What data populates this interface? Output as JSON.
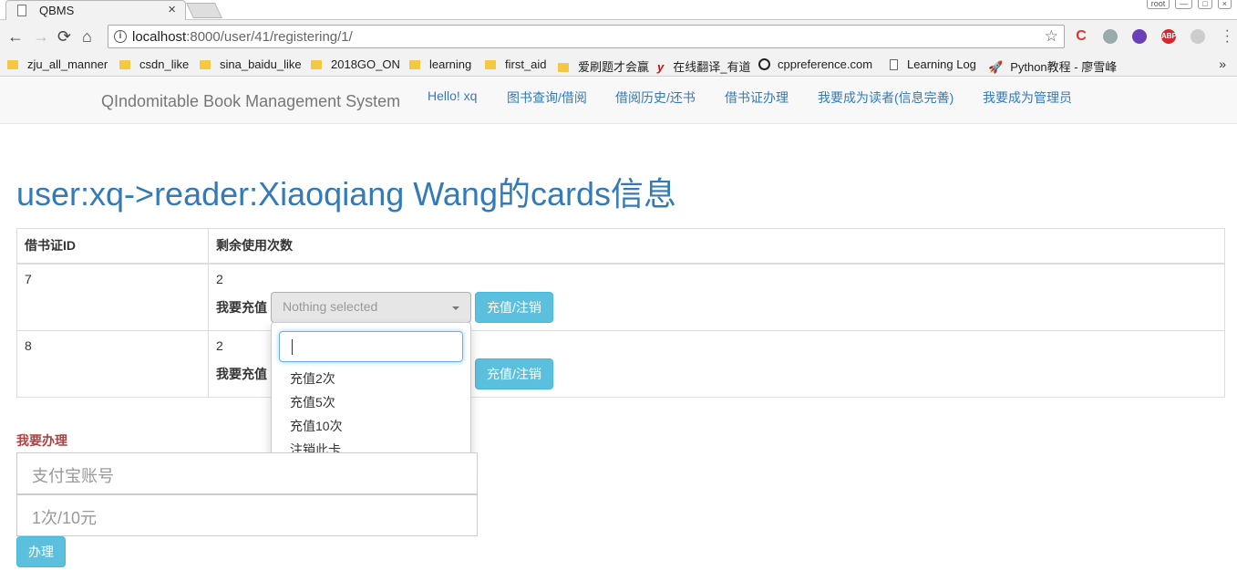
{
  "browser": {
    "tab_title": "QBMS",
    "tab_close": "×",
    "url_host": "localhost",
    "url_rest": ":8000/user/41/registering/1/",
    "bookmarks": [
      "zju_all_manner",
      "csdn_like",
      "sina_baidu_like",
      "2018GO_ON",
      "learning",
      "first_aid",
      "爱刷题才会赢",
      "在线翻译_有道",
      "cppreference.com",
      "Learning Log",
      "Python教程 - 廖雪峰"
    ],
    "bookmarks_more": "»",
    "window_buttons": [
      "root",
      "—",
      "□",
      "×"
    ],
    "extensions": [
      "C",
      "",
      "",
      "ABP",
      ""
    ]
  },
  "navbar": {
    "brand": "QIndomitable Book Management System",
    "links": [
      "Hello! xq",
      "图书查询/借阅",
      "借阅历史/还书",
      "借书证办理",
      "我要成为读者(信息完善)",
      "我要成为管理员"
    ]
  },
  "page": {
    "title": "user:xq->reader:Xiaoqiang Wang的cards信息",
    "table": {
      "headers": [
        "借书证ID",
        "剩余使用次数"
      ],
      "rows": [
        {
          "id": "7",
          "remaining": "2",
          "label": "我要充值",
          "select_placeholder": "Nothing selected",
          "button": "充值/注销"
        },
        {
          "id": "8",
          "remaining": "2",
          "label": "我要充值",
          "select_placeholder": "",
          "button": "充值/注销"
        }
      ]
    },
    "dropdown": {
      "options": [
        "充值2次",
        "充值5次",
        "充值10次",
        "注销此卡"
      ]
    },
    "apply": {
      "label": "我要办理",
      "alipay_placeholder": "支付宝账号",
      "price_placeholder": "1次/10元",
      "submit": "办理"
    }
  }
}
